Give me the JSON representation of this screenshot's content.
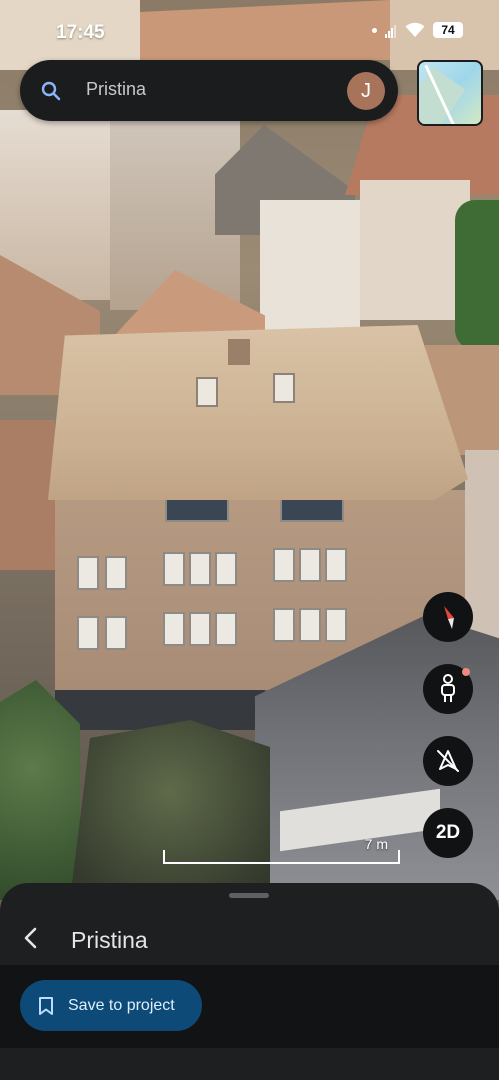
{
  "status_bar": {
    "time": "17:45",
    "battery": "74"
  },
  "search": {
    "query": "Pristina",
    "avatar_initial": "J"
  },
  "controls": {
    "view_mode_label": "2D"
  },
  "scale": {
    "label": "7 m"
  },
  "place_sheet": {
    "title": "Pristina",
    "save_button_label": "Save to project"
  },
  "colors": {
    "accent_button": "#0d4a78",
    "sheet_bg": "#1e1f21",
    "search_bg": "#1b1c1e",
    "avatar": "#a7735a"
  }
}
